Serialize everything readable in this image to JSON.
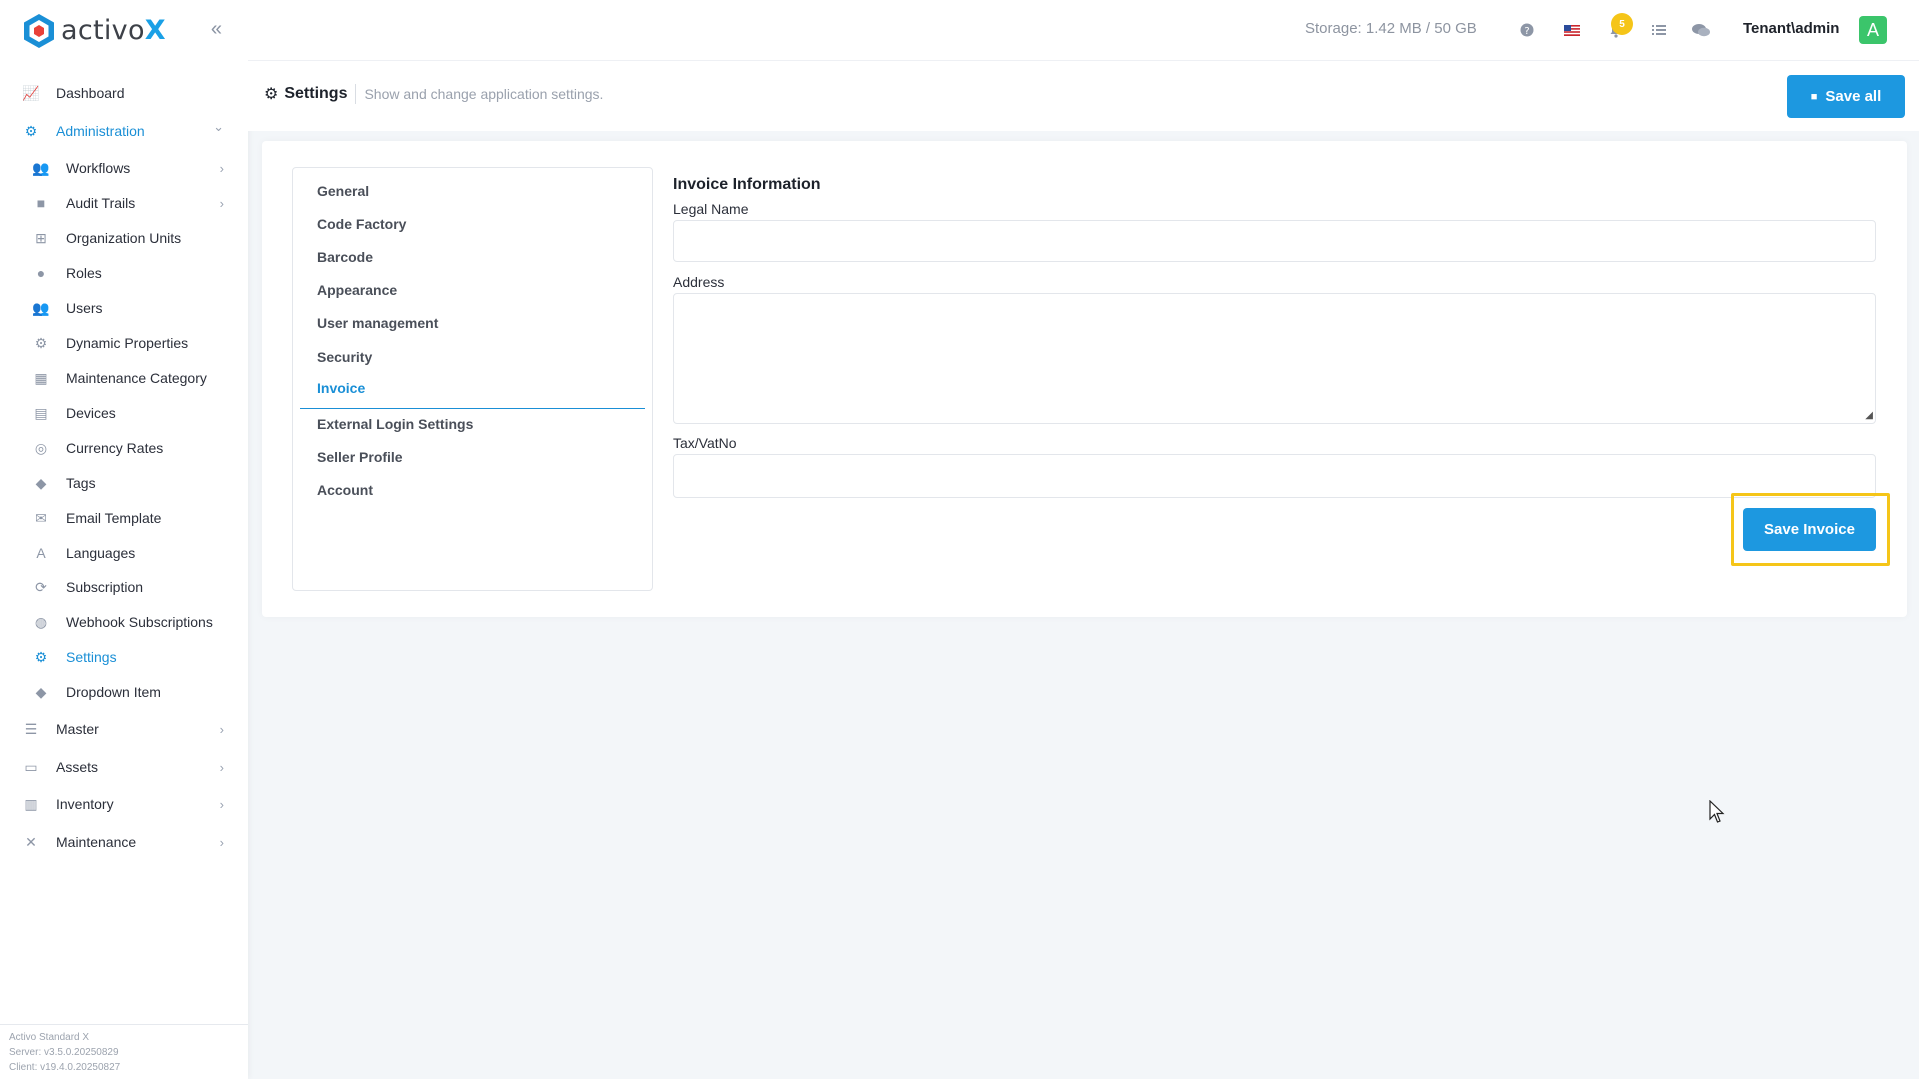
{
  "app": {
    "brand_name": "activo",
    "brand_suffix": "X"
  },
  "header": {
    "storage": "Storage: 1.42 MB / 50 GB",
    "notification_count": "5",
    "user_name": "Tenant\\admin",
    "avatar_letter": "A"
  },
  "sidebar": {
    "items": [
      {
        "label": "Dashboard",
        "level": "top",
        "icon": "chart-line-icon",
        "glyph": "📈"
      },
      {
        "label": "Administration",
        "level": "top",
        "icon": "cogs-icon",
        "glyph": "⚙"
      },
      {
        "label": "Workflows",
        "level": "sub",
        "icon": "users-icon",
        "glyph": "👥"
      },
      {
        "label": "Audit Trails",
        "level": "sub",
        "icon": "folder-icon",
        "glyph": "■"
      },
      {
        "label": "Organization Units",
        "level": "sub",
        "icon": "sitemap-icon",
        "glyph": "⊞"
      },
      {
        "label": "Roles",
        "level": "sub",
        "icon": "user-lock-icon",
        "glyph": "●"
      },
      {
        "label": "Users",
        "level": "sub",
        "icon": "users-icon",
        "glyph": "👥"
      },
      {
        "label": "Dynamic Properties",
        "level": "sub",
        "icon": "cog-icon",
        "glyph": "⚙"
      },
      {
        "label": "Maintenance Category",
        "level": "sub",
        "icon": "grid-icon",
        "glyph": "▦"
      },
      {
        "label": "Devices",
        "level": "sub",
        "icon": "printer-icon",
        "glyph": "▤"
      },
      {
        "label": "Currency Rates",
        "level": "sub",
        "icon": "coins-icon",
        "glyph": "◎"
      },
      {
        "label": "Tags",
        "level": "sub",
        "icon": "tags-icon",
        "glyph": "◆"
      },
      {
        "label": "Email Template",
        "level": "sub",
        "icon": "envelope-icon",
        "glyph": "✉"
      },
      {
        "label": "Languages",
        "level": "sub",
        "icon": "language-icon",
        "glyph": "A"
      },
      {
        "label": "Subscription",
        "level": "sub",
        "icon": "sync-icon",
        "glyph": "⟳"
      },
      {
        "label": "Webhook Subscriptions",
        "level": "sub",
        "icon": "globe-icon",
        "glyph": "◍"
      },
      {
        "label": "Settings",
        "level": "sub",
        "icon": "cog-icon",
        "glyph": "⚙"
      },
      {
        "label": "Dropdown Item",
        "level": "sub",
        "icon": "tags-icon",
        "glyph": "◆"
      },
      {
        "label": "Master",
        "level": "top",
        "icon": "database-icon",
        "glyph": "☰"
      },
      {
        "label": "Assets",
        "level": "top",
        "icon": "laptop-icon",
        "glyph": "▭"
      },
      {
        "label": "Inventory",
        "level": "top",
        "icon": "warehouse-icon",
        "glyph": "▥"
      },
      {
        "label": "Maintenance",
        "level": "top",
        "icon": "tools-icon",
        "glyph": "✕"
      }
    ],
    "footer": {
      "product": "Activo Standard X",
      "server": "Server: v3.5.0.20250829",
      "client": "Client: v19.4.0.20250827"
    }
  },
  "subheader": {
    "title": "Settings",
    "description": "Show and change application settings.",
    "save_all_label": "Save all"
  },
  "settings_tabs": [
    "General",
    "Code Factory",
    "Barcode",
    "Appearance",
    "User management",
    "Security",
    "Invoice",
    "External Login Settings",
    "Seller Profile",
    "Account"
  ],
  "active_tab": "Invoice",
  "invoice_form": {
    "section_title": "Invoice Information",
    "legal_name_label": "Legal Name",
    "legal_name_value": "",
    "address_label": "Address",
    "address_value": "",
    "tax_label": "Tax/VatNo",
    "tax_value": "",
    "save_label": "Save Invoice"
  },
  "colors": {
    "accent": "#1d98e0",
    "highlight": "#f5c518",
    "avatar": "#3bc56b"
  }
}
